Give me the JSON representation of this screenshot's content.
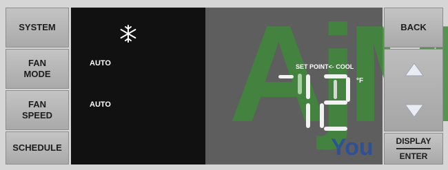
{
  "left_buttons": [
    {
      "label": "SYSTEM"
    },
    {
      "label": "FAN\nMODE"
    },
    {
      "label": "FAN\nSPEED"
    },
    {
      "label": "SCHEDULE"
    }
  ],
  "right_buttons": {
    "back": "BACK",
    "display": "DISPLAY",
    "enter": "ENTER"
  },
  "lcd": {
    "fan_mode_value": "AUTO",
    "fan_speed_value": "AUTO",
    "set_point_label": "SET POINT<- COOL",
    "unit": "°F",
    "mode_icon": "snowflake-icon"
  },
  "watermark": {
    "big": "AjM",
    "small": "You"
  },
  "colors": {
    "panel": "#d6d6d6",
    "button": "#b8b8b8",
    "lcd_bg": "#111111",
    "watermark_green": "#3f8a3a",
    "watermark_blue": "#2a4f9a"
  }
}
